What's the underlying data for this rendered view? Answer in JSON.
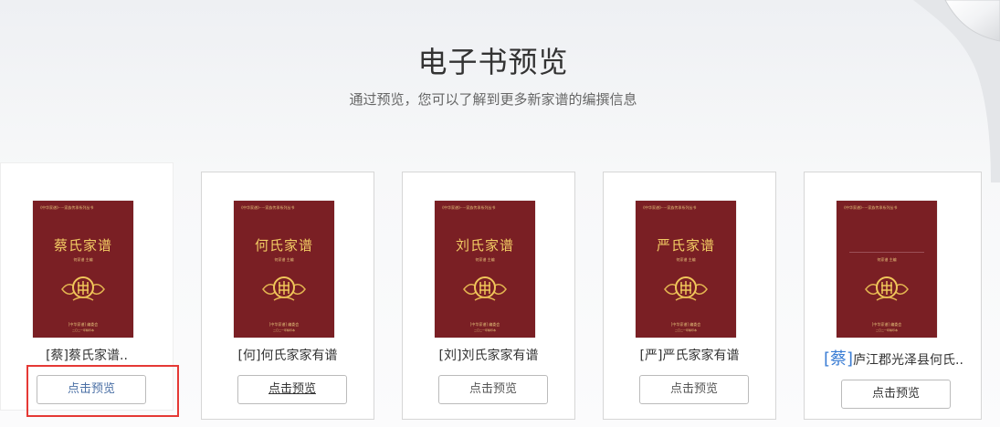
{
  "header": {
    "title": "电子书预览",
    "subtitle": "通过预览，您可以了解到更多新家谱的编撰信息"
  },
  "books": [
    {
      "cover_title": "蔡氏家谱",
      "caption_tag": "[蔡]",
      "caption_text": "蔡氏家谱..",
      "button": "点击预览"
    },
    {
      "cover_title": "何氏家谱",
      "caption_tag": "[何]",
      "caption_text": "何氏家家有谱",
      "button": "点击预览"
    },
    {
      "cover_title": "刘氏家谱",
      "caption_tag": "[刘]",
      "caption_text": "刘氏家家有谱",
      "button": "点击预览"
    },
    {
      "cover_title": "严氏家谱",
      "caption_tag": "[严]",
      "caption_text": "严氏家家有谱",
      "button": "点击预览"
    },
    {
      "cover_title": "",
      "caption_tag": "[蔡]",
      "caption_text": "庐江郡光泽县何氏..",
      "button": "点击预览"
    }
  ],
  "colors": {
    "cover": "#7a1f24",
    "cover_text": "#f2cc64",
    "highlight": "#e53935",
    "link_tag": "#3a7dd4"
  }
}
